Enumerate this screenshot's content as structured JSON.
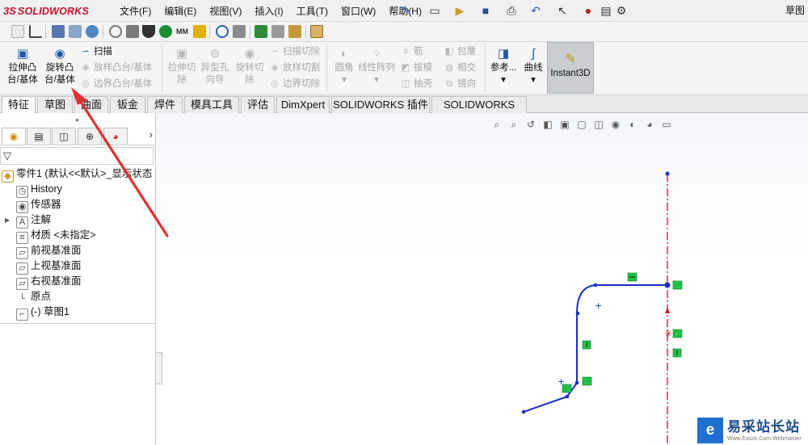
{
  "app": {
    "logo_ds": "3S",
    "logo_text": "SOLIDWORKS",
    "document_name": "草图"
  },
  "menu": [
    "文件(F)",
    "编辑(E)",
    "视图(V)",
    "插入(I)",
    "工具(T)",
    "窗口(W)",
    "帮助(H)"
  ],
  "ribbon": {
    "extrude_boss": {
      "label_1": "拉伸凸",
      "label_2": "台/基体"
    },
    "revolve_boss": {
      "label_1": "旋转凸",
      "label_2": "台/基体"
    },
    "sweep": "扫描",
    "loft_boss": "放样凸台/基体",
    "boundary_boss": "边界凸台/基体",
    "extrude_cut": {
      "label_1": "拉伸切",
      "label_2": "除"
    },
    "hole_wizard": {
      "label_1": "异型孔",
      "label_2": "向导"
    },
    "revolve_cut": {
      "label_1": "旋转切",
      "label_2": "除"
    },
    "sweep_cut": "扫描切除",
    "loft_cut": "放样切割",
    "boundary_cut": "边界切除",
    "fillet": "圆角",
    "linear_pattern": "线性阵列",
    "rib": "筋",
    "draft": "拔模",
    "shell": "抽壳",
    "wrap": "包覆",
    "intersect": "相交",
    "mirror": "镜向",
    "reference": "参考...",
    "curves": "曲线",
    "instant3d": "Instant3D"
  },
  "tabs": [
    "特征",
    "草图",
    "曲面",
    "钣金",
    "焊件",
    "模具工具",
    "评估",
    "DimXpert",
    "SOLIDWORKS 插件",
    "SOLIDWORKS MBD"
  ],
  "active_tab": "特征",
  "tree": {
    "root": "零件1 (默认<<默认>_显示状态",
    "items": [
      "History",
      "传感器",
      "注解",
      "材质 <未指定>",
      "前视基准面",
      "上视基准面",
      "右视基准面",
      "原点",
      "(-) 草图1"
    ]
  },
  "watermark": {
    "title": "易采站长站",
    "subtitle": "Www.Easck.Com  Webmaster",
    "logo_letter": "e"
  },
  "colors": {
    "sketch_line": "#1a2fbf",
    "centerline": "#c0143c",
    "relation_badge": "#22c04a",
    "arrow": "#e03030",
    "brand": "#c8102e"
  }
}
